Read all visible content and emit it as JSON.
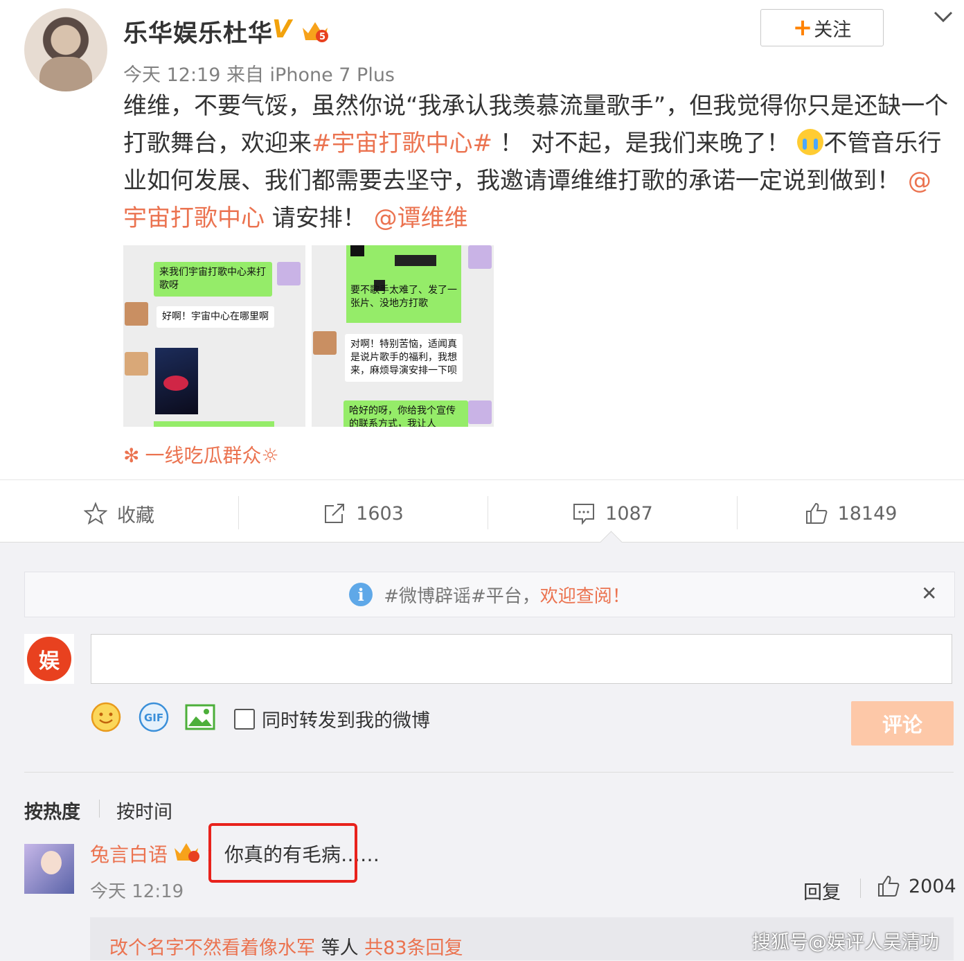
{
  "post": {
    "author": "乐华娱乐杜华",
    "verified_badge": "V",
    "meta": "今天 12:19 来自 iPhone 7 Plus",
    "follow_label": "关注",
    "follow_plus": "+",
    "body": {
      "p1": "维维，不要气馁，虽然你说“我承认我羡慕流量歌手”，但我觉得你只是还缺一个打歌舞台，欢迎来",
      "hashtag": "#宇宙打歌中心#",
      "p2": " ！ 对不起，是我们来晚了！",
      "p3": "不管音乐行业如何发展、我们都需要去坚守，我邀请谭维维打歌的承诺一定说到做到！",
      "mention1": "@宇宙打歌中心",
      "p4": " 请安排！ ",
      "mention2": "@谭维维"
    },
    "images": [
      {
        "bubbles": [
          "来我们宇宙打歌中心来打歌呀",
          "好啊！宇宙中心在哪里啊"
        ]
      },
      {
        "bubbles": [
          "要不歌手太难了、发了一张片、没地方打歌",
          "对啊！特别苦恼，适闻真是说片歌手的福利，我想来，麻烦导演安排一下呗",
          "哈好的呀，你给我个宣传的联系方式，我让人"
        ]
      }
    ],
    "source": "一线吃瓜群众",
    "source_icon": "✻",
    "source_suffix": "☼"
  },
  "actions": {
    "favorite_label": "收藏",
    "repost_count": "1603",
    "comment_count": "1087",
    "like_count": "18149"
  },
  "notice": {
    "prefix": "#微博辟谣#平台，",
    "link": "欢迎查阅！",
    "close": "✕"
  },
  "composer": {
    "avatar_text": "娱",
    "checkbox_label": "同时转发到我的微博",
    "submit_label": "评论"
  },
  "sort": {
    "hot": "按热度",
    "time": "按时间"
  },
  "comment": {
    "name": "兔言白语",
    "colon": "：",
    "text": "你真的有毛病……",
    "time": "今天 12:19",
    "reply_label": "回复",
    "likes": "2004",
    "sub_reply": {
      "user": "改个名字不然看着像水军",
      "middle": " 等人 ",
      "total": "共83条回复"
    }
  },
  "watermark": "搜狐号@娱评人吴清功",
  "colors": {
    "accent": "#eb7350",
    "follow_plus": "#ff8200",
    "verified": "#f2a20c",
    "submit_disabled": "#fdc8a8",
    "highlight_box": "#e8221c"
  },
  "icons": [
    "star-icon",
    "repost-icon",
    "comment-icon",
    "thumbs-up-icon",
    "info-icon",
    "close-icon",
    "emoji-icon",
    "gif-icon",
    "image-icon",
    "chevron-down-icon",
    "crown-icon"
  ]
}
